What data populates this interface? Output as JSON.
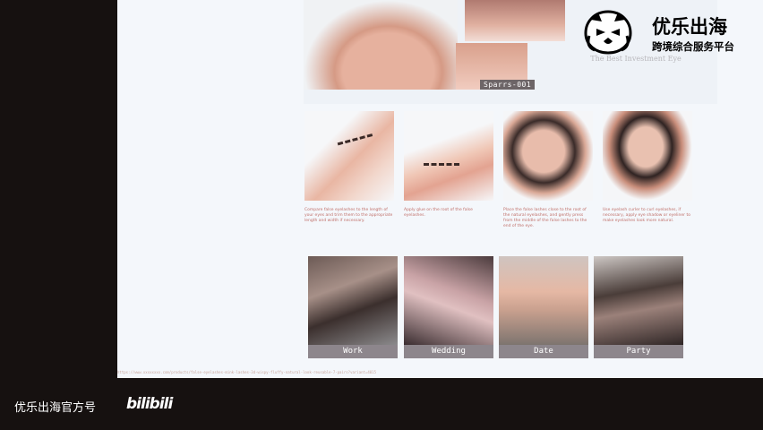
{
  "hero": {
    "model_tag": "Sparrs-001",
    "caption": "The Best Investment Eye"
  },
  "steps": [
    {
      "text": "Compare false eyelashes to the length of your eyes and trim them to the appropriate length and width if necessary."
    },
    {
      "text": "Apply glue on the root of the false eyelashes."
    },
    {
      "text": "Place the false lashes close to the root of the natural eyelashes, and gently press from the middle of the false lashes to the end of the eye."
    },
    {
      "text": "Use eyelash curler to curl eyelashes, if necessary, apply eye shadow or eyeliner to make eyelashes look more natural."
    }
  ],
  "scenes": [
    {
      "label": "Work"
    },
    {
      "label": "Wedding"
    },
    {
      "label": "Date"
    },
    {
      "label": "Party"
    }
  ],
  "status_url": "https://www.xxxxxxxx.com/products/false-eyelashes-mink-lashes-3d-wispy-fluffy-natural-look-reusable-7-pairs?variant=4015",
  "brand": {
    "name": "优乐出海",
    "subtitle": "跨境综合服务平台",
    "logo_icon": "lion-head-icon"
  },
  "watermark": {
    "text": "优乐出海官方号",
    "platform": "bilibili"
  }
}
